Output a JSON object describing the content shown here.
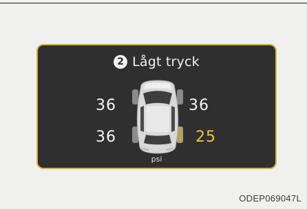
{
  "warning": {
    "badge_number": "2",
    "message": "Lågt tryck"
  },
  "tires": {
    "front_left": "36",
    "front_right": "36",
    "rear_left": "36",
    "rear_right": "25"
  },
  "unit": "psi",
  "figure_code": "ODEP069047L",
  "colors": {
    "page_background": "#f0f0ef",
    "panel_background": "#2f2f2f",
    "panel_border": "#d4b43a",
    "normal_pressure": "#f4f4f4",
    "low_pressure": "#f2c233"
  },
  "icons": {
    "warning_badge": "number-2-circle-icon",
    "vehicle": "car-top-view-icon"
  }
}
